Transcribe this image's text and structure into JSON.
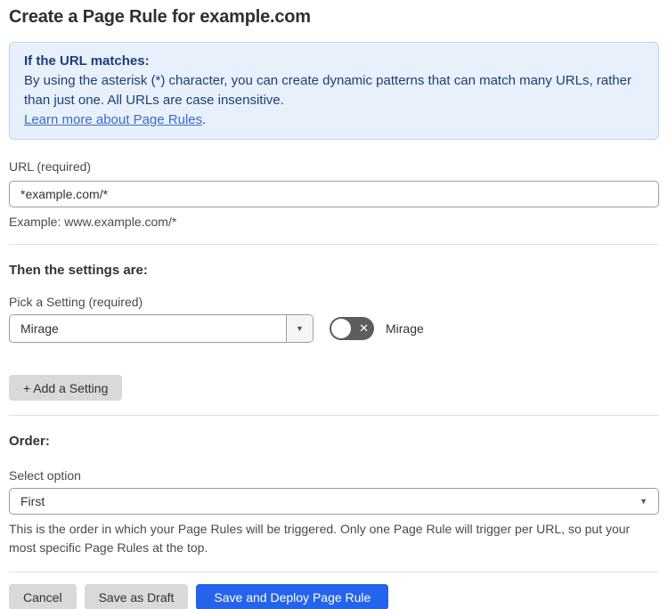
{
  "page": {
    "title": "Create a Page Rule for example.com"
  },
  "info_box": {
    "heading": "If the URL matches:",
    "body": "By using the asterisk (*) character, you can create dynamic patterns that can match many URLs, rather than just one. All URLs are case insensitive.",
    "link_label": "Learn more about Page Rules",
    "link_suffix": "."
  },
  "url_field": {
    "label": "URL (required)",
    "value": "*example.com/*",
    "helper": "Example: www.example.com/*"
  },
  "settings_section": {
    "heading": "Then the settings are:",
    "picker_label": "Pick a Setting (required)",
    "selected_setting": "Mirage",
    "dropdown_caret": "▼",
    "toggle": {
      "state": "off",
      "off_glyph": "✕",
      "label": "Mirage"
    },
    "add_button_label": "+ Add a Setting"
  },
  "order_section": {
    "heading": "Order:",
    "label": "Select option",
    "selected_option": "First",
    "dropdown_caret": "▼",
    "helper": "This is the order in which your Page Rules will be triggered. Only one Page Rule will trigger per URL, so put your most specific Page Rules at the top."
  },
  "footer": {
    "cancel_label": "Cancel",
    "save_draft_label": "Save as Draft",
    "save_deploy_label": "Save and Deploy Page Rule"
  },
  "colors": {
    "info_bg": "#e8f1fb",
    "info_border": "#b9d4f0",
    "info_text": "#1c3d77",
    "link": "#3a6bc7",
    "primary_button": "#2463eb",
    "toggle_off_track": "#5d5d5d",
    "gray_button": "#d9d9d9"
  }
}
